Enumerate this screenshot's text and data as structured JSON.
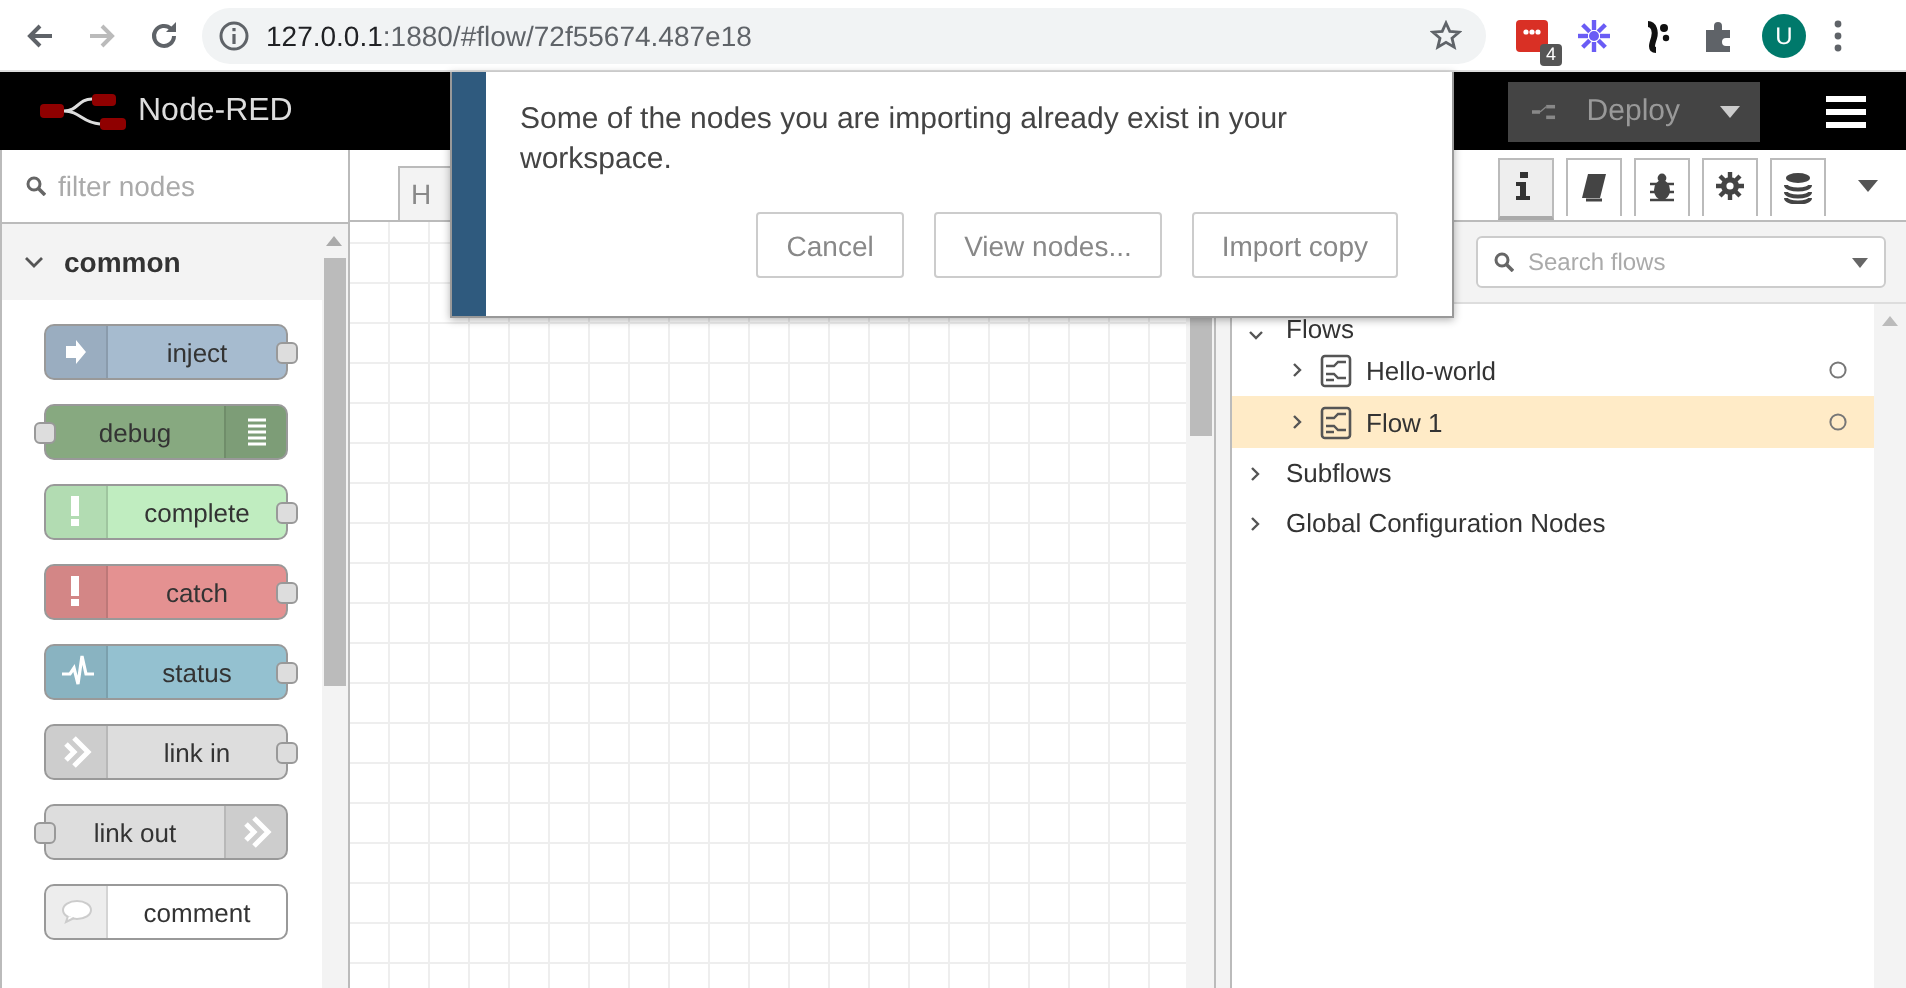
{
  "browser": {
    "url_host": "127.0.0.1",
    "url_rest": ":1880/#flow/72f55674.487e18",
    "back_disabled": false,
    "forward_disabled": true,
    "extension_badge": "4",
    "avatar": "U"
  },
  "header": {
    "title": "Node-RED",
    "deploy": "Deploy"
  },
  "palette": {
    "filter_placeholder": "filter nodes",
    "category": "common",
    "expanded": true,
    "nodes": [
      {
        "label": "inject",
        "kind": "output",
        "color": "#a6bbcf"
      },
      {
        "label": "debug",
        "kind": "input",
        "color": "#87a980"
      },
      {
        "label": "complete",
        "kind": "output",
        "color": "#c0edc0"
      },
      {
        "label": "catch",
        "kind": "output",
        "color": "#e49191"
      },
      {
        "label": "status",
        "kind": "output",
        "color": "#94c1d0"
      },
      {
        "label": "link in",
        "kind": "output",
        "color": "#dddddd"
      },
      {
        "label": "link out",
        "kind": "input",
        "color": "#dddddd"
      },
      {
        "label": "comment",
        "kind": "none",
        "color": "#ffffff"
      }
    ]
  },
  "workspace": {
    "tabs": [
      {
        "label": "H",
        "selected": true
      }
    ]
  },
  "sidebar": {
    "tabs": [
      {
        "selected": true
      },
      {
        "selected": false
      },
      {
        "selected": false
      },
      {
        "selected": false
      },
      {
        "selected": false
      }
    ],
    "search_placeholder": "Search flows",
    "tree": [
      {
        "label": "Flows",
        "expanded": true,
        "children": [
          {
            "label": "Hello-world",
            "selected": false
          },
          {
            "label": "Flow 1",
            "selected": true
          }
        ]
      },
      {
        "label": "Subflows",
        "expanded": false
      },
      {
        "label": "Global Configuration Nodes",
        "expanded": false
      }
    ]
  },
  "dialog": {
    "message": "Some of the nodes you are importing already exist in your workspace.",
    "buttons": [
      "Cancel",
      "View nodes...",
      "Import copy"
    ]
  }
}
